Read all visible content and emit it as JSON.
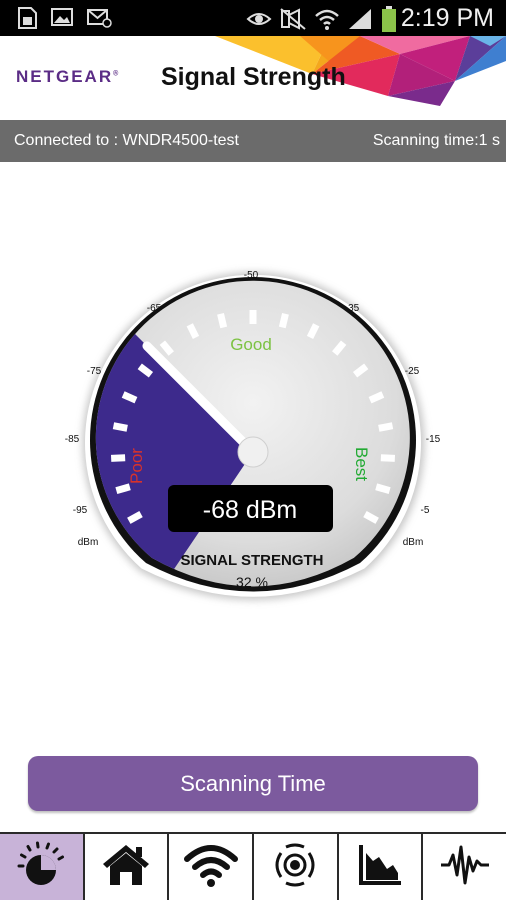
{
  "status_bar": {
    "time": "2:19 PM",
    "icons": [
      "sim-card-icon",
      "gallery-icon",
      "email-icon",
      "eye-icon",
      "mute-icon",
      "wifi-icon",
      "cell-signal-icon",
      "battery-icon"
    ]
  },
  "header": {
    "brand": "NETGEAR",
    "brand_mark": "®",
    "title": "Signal Strength"
  },
  "info_bar": {
    "connected": "Connected to : WNDR4500-test",
    "scanning_time": "Scanning time:1 s"
  },
  "gauge": {
    "scale_labels": [
      "-95",
      "-85",
      "-75",
      "-65",
      "-50",
      "-35",
      "-25",
      "-15",
      "-5"
    ],
    "unit_left": "dBm",
    "unit_right": "dBm",
    "zone_poor": "Poor",
    "zone_good": "Good",
    "zone_best": "Best",
    "reading": "-68 dBm",
    "caption": "SIGNAL STRENGTH",
    "percent": "32 %",
    "colors": {
      "poor_zone": "#3d2a8c",
      "poor_label": "#d9322a",
      "good_label": "#7cc242",
      "best_label": "#22aa33"
    }
  },
  "scan_button": {
    "label": "Scanning Time"
  },
  "bottom_nav": {
    "tabs": [
      {
        "name": "gauge-tab",
        "icon": "gauge-icon",
        "active": true
      },
      {
        "name": "home-tab",
        "icon": "home-icon",
        "active": false
      },
      {
        "name": "wifi-tab",
        "icon": "wifi-icon",
        "active": false
      },
      {
        "name": "broadcast-tab",
        "icon": "broadcast-icon",
        "active": false
      },
      {
        "name": "chart-tab",
        "icon": "chart-icon",
        "active": false
      },
      {
        "name": "waveform-tab",
        "icon": "waveform-icon",
        "active": false
      }
    ]
  },
  "theme": {
    "accent": "#7c5a9e",
    "active_tab": "#c8b3d8",
    "info_bar": "#6b6b6b"
  }
}
